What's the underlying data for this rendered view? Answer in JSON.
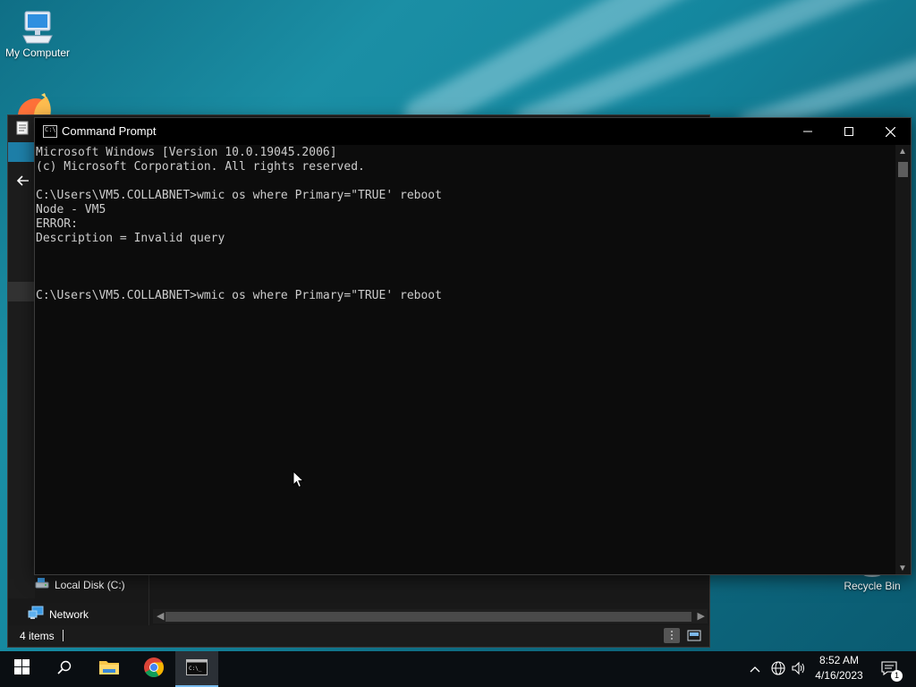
{
  "desktop": {
    "icons": [
      {
        "label": "My Computer",
        "icon": "computer-icon"
      },
      {
        "label": "Recycle Bin",
        "icon": "recycle-bin-icon"
      }
    ]
  },
  "explorer": {
    "nav_items": [
      {
        "label": "Local Disk (C:)",
        "icon": "drive-icon"
      },
      {
        "label": "Network",
        "icon": "network-icon"
      }
    ],
    "status": {
      "item_count": "4 items"
    }
  },
  "cmd": {
    "title": "Command Prompt",
    "buttons": {
      "minimize": "—",
      "maximize": "☐",
      "close": "✕"
    },
    "lines": [
      "Microsoft Windows [Version 10.0.19045.2006]",
      "(c) Microsoft Corporation. All rights reserved.",
      "",
      "C:\\Users\\VM5.COLLABNET>wmic os where Primary=\"TRUE' reboot",
      "Node - VM5",
      "ERROR:",
      "Description = Invalid query",
      "",
      "",
      "",
      "C:\\Users\\VM5.COLLABNET>wmic os where Primary=\"TRUE' reboot"
    ]
  },
  "taskbar": {
    "apps": [
      {
        "name": "start",
        "icon": "windows-logo-icon"
      },
      {
        "name": "search",
        "icon": "search-icon"
      },
      {
        "name": "file-explorer",
        "icon": "folder-icon"
      },
      {
        "name": "chrome",
        "icon": "chrome-icon"
      },
      {
        "name": "command-prompt",
        "icon": "cmd-icon",
        "active": true
      }
    ],
    "tray": {
      "icons": [
        "chevron-up-icon",
        "network-globe-icon",
        "volume-icon"
      ],
      "time": "8:52 AM",
      "date": "4/16/2023",
      "notifications": "1"
    }
  },
  "colors": {
    "console_bg": "#0c0c0c",
    "console_text": "#cccccc",
    "taskbar": "#0a0e12",
    "accent": "#76b9ed"
  }
}
